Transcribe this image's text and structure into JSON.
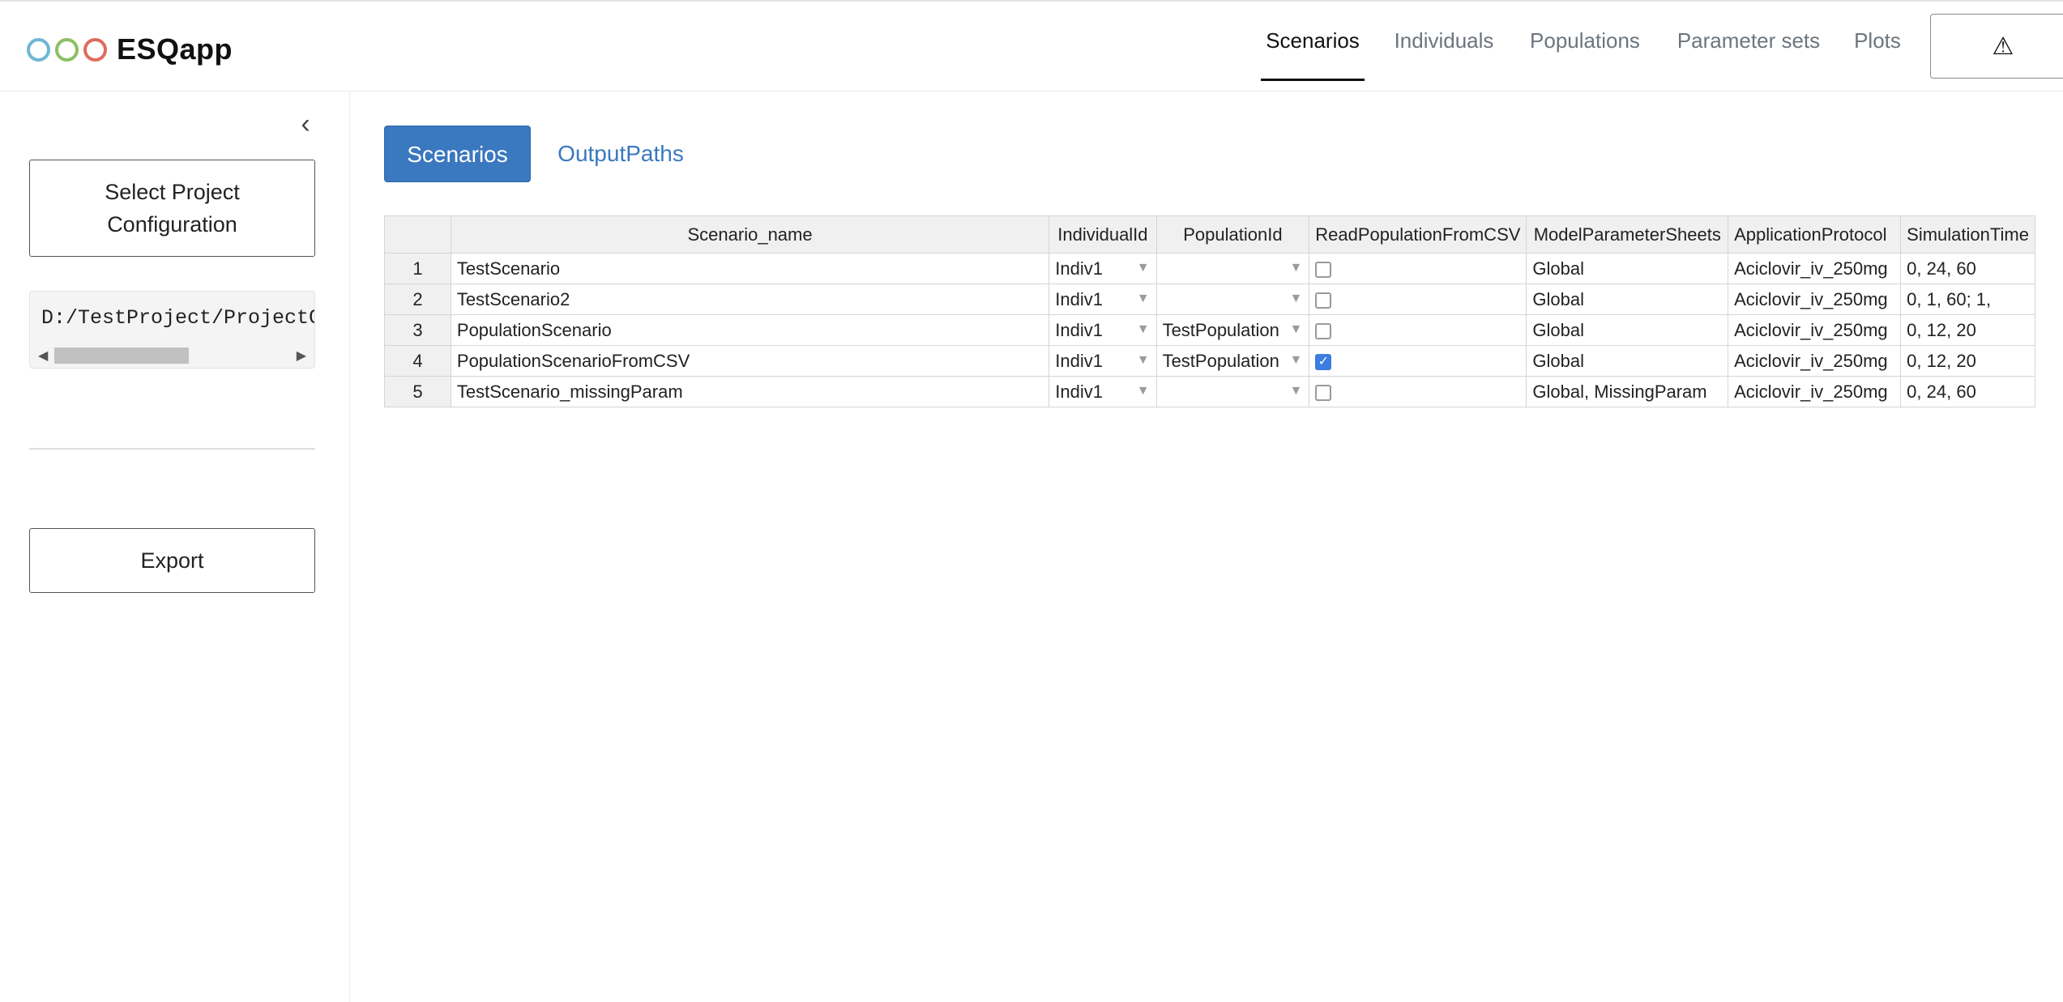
{
  "app": {
    "title": "ESQapp",
    "logo_colors": [
      "#6fb7d3",
      "#8cc063",
      "#e06b5e"
    ]
  },
  "nav": {
    "items": [
      {
        "label": "Scenarios",
        "active": true
      },
      {
        "label": "Individuals",
        "active": false
      },
      {
        "label": "Populations",
        "active": false
      },
      {
        "label": "Parameter sets",
        "active": false
      },
      {
        "label": "Plots",
        "active": false
      }
    ],
    "warning_icon": "warning-triangle-icon",
    "warning_glyph": "⚠"
  },
  "sidebar": {
    "collapse_icon": "chevron-left-icon",
    "collapse_glyph": "‹",
    "select_label_line1": "Select Project",
    "select_label_line2": "Configuration",
    "project_path": "D:/TestProject/ProjectConfiguration.xlsx",
    "export_label": "Export"
  },
  "tabs": {
    "scenarios": "Scenarios",
    "output_paths": "OutputPaths"
  },
  "table": {
    "columns": [
      "",
      "Scenario_name",
      "IndividualId",
      "PopulationId",
      "ReadPopulationFromCSV",
      "ModelParameterSheets",
      "ApplicationProtocol",
      "SimulationTime"
    ],
    "rows": [
      {
        "index": "1",
        "scenario_name": "TestScenario",
        "individual_id": "Indiv1",
        "population_id": "",
        "read_csv": false,
        "model_parameter_sheets": "Global",
        "application_protocol": "Aciclovir_iv_250mg",
        "simulation_time": "0, 24, 60"
      },
      {
        "index": "2",
        "scenario_name": "TestScenario2",
        "individual_id": "Indiv1",
        "population_id": "",
        "read_csv": false,
        "model_parameter_sheets": "Global",
        "application_protocol": "Aciclovir_iv_250mg",
        "simulation_time": "0, 1, 60; 1,"
      },
      {
        "index": "3",
        "scenario_name": "PopulationScenario",
        "individual_id": "Indiv1",
        "population_id": "TestPopulation",
        "read_csv": false,
        "model_parameter_sheets": "Global",
        "application_protocol": "Aciclovir_iv_250mg",
        "simulation_time": "0, 12, 20"
      },
      {
        "index": "4",
        "scenario_name": "PopulationScenarioFromCSV",
        "individual_id": "Indiv1",
        "population_id": "TestPopulation",
        "read_csv": true,
        "model_parameter_sheets": "Global",
        "application_protocol": "Aciclovir_iv_250mg",
        "simulation_time": "0, 12, 20"
      },
      {
        "index": "5",
        "scenario_name": "TestScenario_missingParam",
        "individual_id": "Indiv1",
        "population_id": "",
        "read_csv": false,
        "model_parameter_sheets": "Global, MissingParam",
        "application_protocol": "Aciclovir_iv_250mg",
        "simulation_time": "0, 24, 60"
      }
    ]
  },
  "colors": {
    "accent": "#3a78bf",
    "checkbox_checked": "#3b7de0"
  }
}
